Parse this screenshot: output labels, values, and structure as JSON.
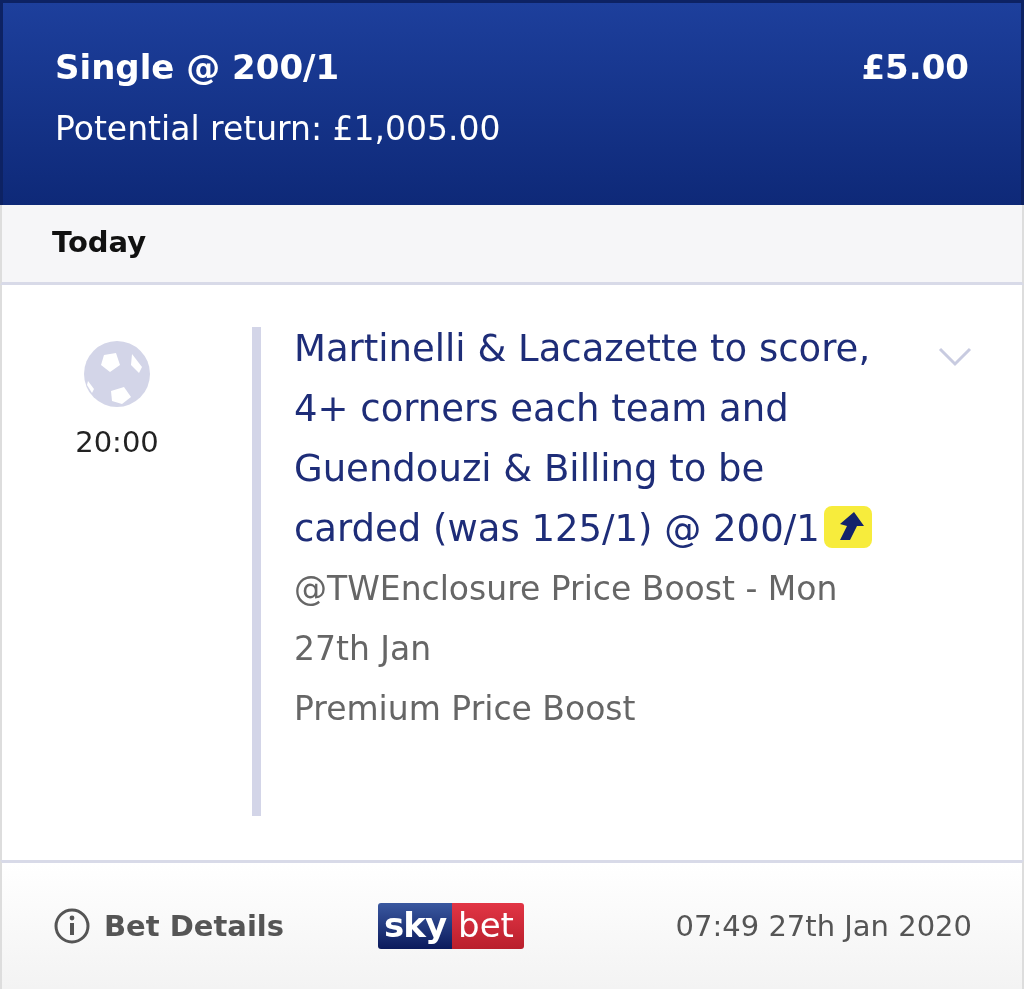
{
  "header": {
    "title": "Single @ 200/1",
    "stake": "£5.00",
    "potential_return": "Potential return: £1,005.00"
  },
  "date_group": "Today",
  "leg": {
    "time": "20:00",
    "selection": "Martinelli & Lacazette to score, 4+ corners each team and Guendouzi & Billing to be carded (was 125/1) @ 200/1",
    "boosted": true,
    "expanded": false,
    "notes": [
      "@TWEnclosure Price Boost - Mon 27th Jan",
      "Premium Price Boost"
    ]
  },
  "footer": {
    "details_link": "Bet Details",
    "logo": [
      "sky",
      "bet"
    ],
    "placed_at": "07:49 27th Jan 2020"
  }
}
